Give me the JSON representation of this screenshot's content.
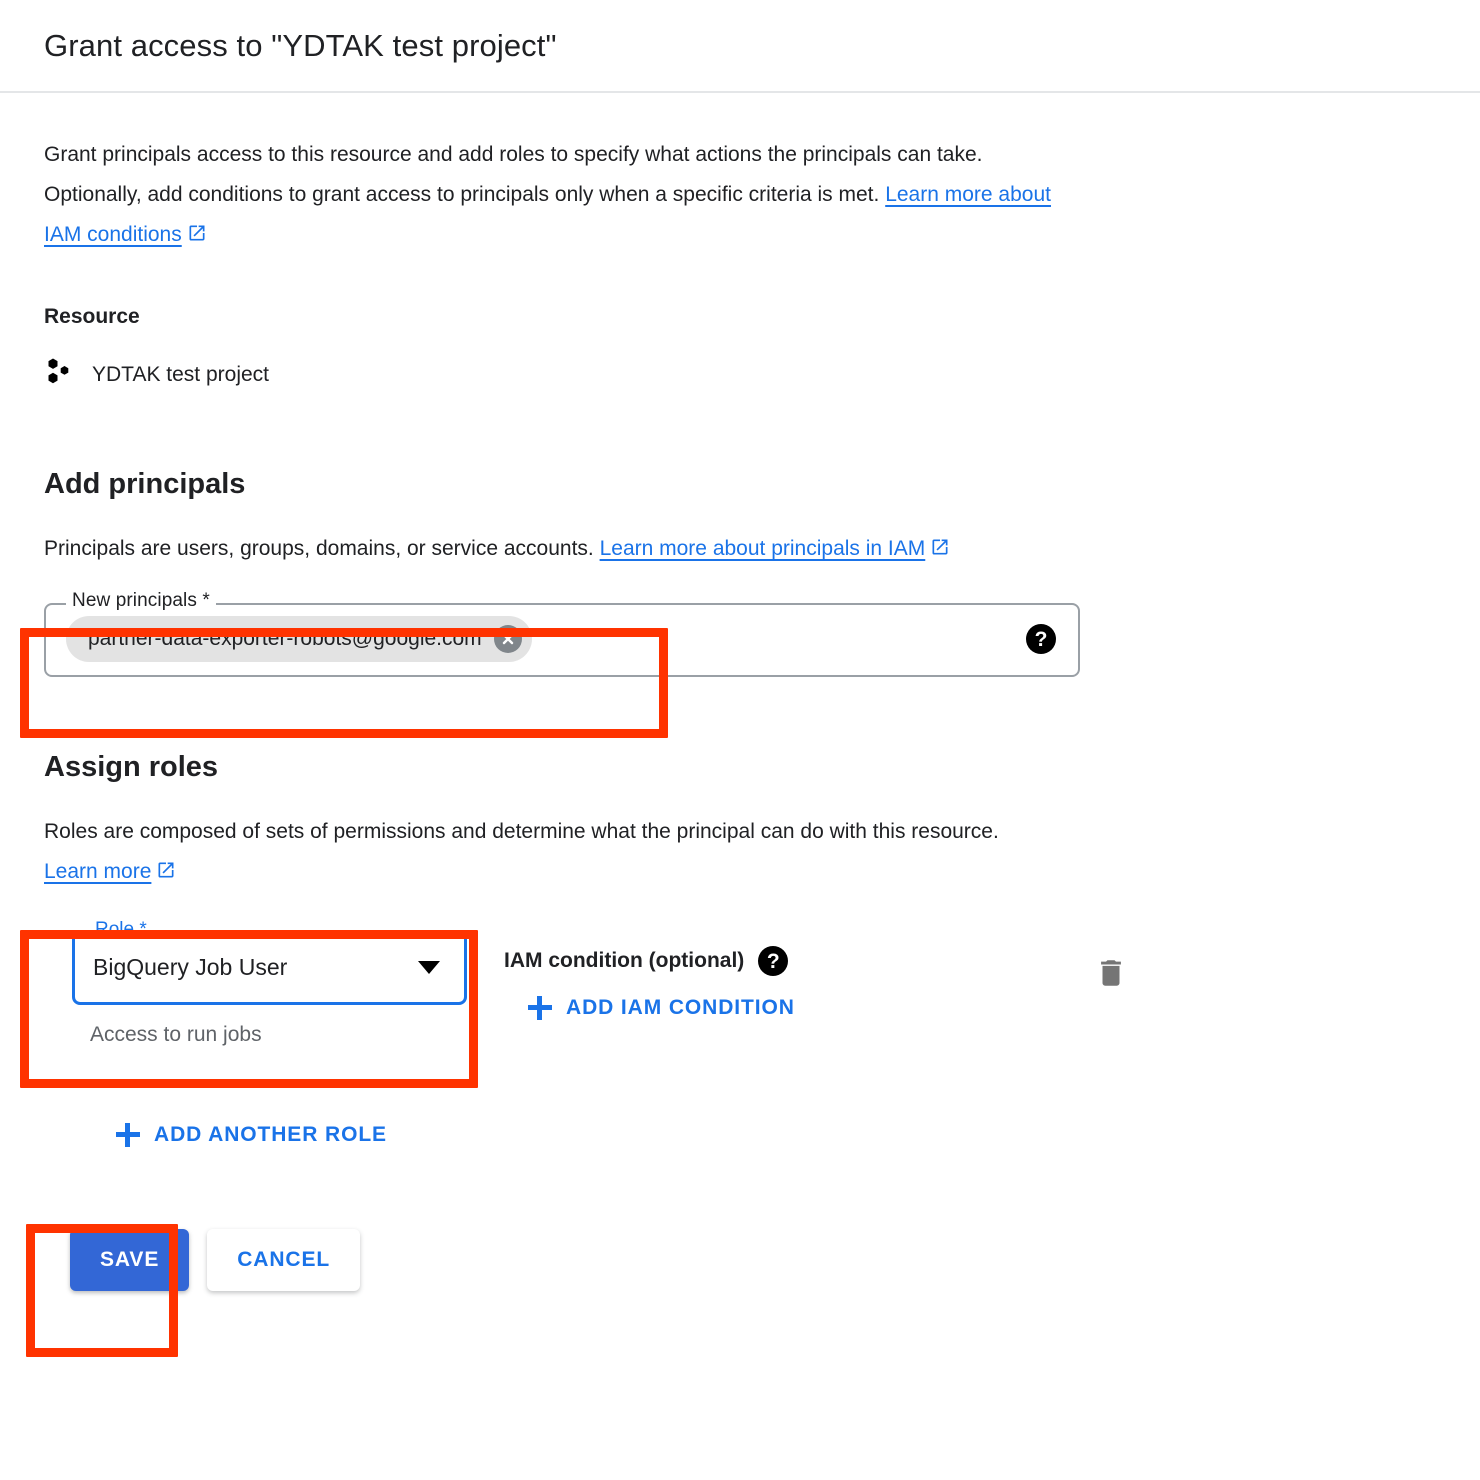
{
  "header": {
    "title": "Grant access to \"YDTAK test project\""
  },
  "intro": {
    "text": "Grant principals access to this resource and add roles to specify what actions the principals can take. Optionally, add conditions to grant access to principals only when a specific criteria is met.",
    "link_label": "Learn more about IAM conditions",
    "external_icon": "external-link-icon"
  },
  "resource": {
    "label": "Resource",
    "icon": "gcp-project-icon",
    "name": "YDTAK test project"
  },
  "add_principals": {
    "heading": "Add principals",
    "description": "Principals are users, groups, domains, or service accounts.",
    "link_label": "Learn more about principals in IAM",
    "field": {
      "label": "New principals *",
      "chip_value": "partner-data-exporter-robots@google.com",
      "chip_remove_icon": "close-circle-icon",
      "help_icon": "help-icon",
      "help_glyph": "?"
    }
  },
  "assign_roles": {
    "heading": "Assign roles",
    "description": "Roles are composed of sets of permissions and determine what the principal can do with this resource.",
    "link_label": "Learn more",
    "role": {
      "label": "Role *",
      "value": "BigQuery Job User",
      "hint": "Access to run jobs",
      "dropdown_icon": "chevron-down-icon",
      "options": [
        "BigQuery Job User"
      ]
    },
    "condition": {
      "label": "IAM condition (optional)",
      "help_icon": "help-icon",
      "help_glyph": "?",
      "add_label": "ADD IAM CONDITION",
      "add_icon": "plus-icon",
      "delete_icon": "trash-icon"
    },
    "add_another_role_label": "ADD ANOTHER ROLE",
    "add_another_role_icon": "plus-icon"
  },
  "actions": {
    "save_label": "SAVE",
    "cancel_label": "CANCEL"
  },
  "colors": {
    "accent_blue": "#1a73e8",
    "primary_button": "#3367d6",
    "annotation_red": "#ff3300",
    "muted_text": "#5f6368",
    "chip_background": "#e3e3e3",
    "field_border": "#9aa0a6"
  }
}
